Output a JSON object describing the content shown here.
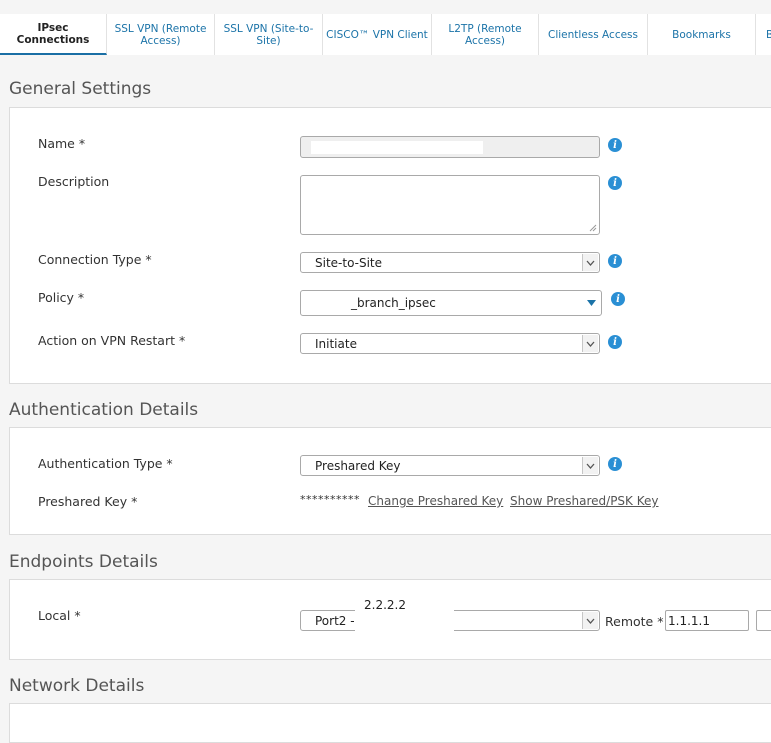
{
  "tabs": [
    {
      "label": "IPsec Connections",
      "active": true
    },
    {
      "label": "SSL VPN (Remote Access)"
    },
    {
      "label": "SSL VPN (Site-to-Site)"
    },
    {
      "label": "CISCO™ VPN Client"
    },
    {
      "label": "L2TP (Remote Access)"
    },
    {
      "label": "Clientless Access"
    },
    {
      "label": "Bookmarks"
    },
    {
      "label": "B"
    }
  ],
  "general": {
    "title": "General Settings",
    "name_label": "Name *",
    "name_value": "",
    "description_label": "Description",
    "description_value": "",
    "connection_type_label": "Connection Type *",
    "connection_type_value": "Site-to-Site",
    "policy_label": "Policy *",
    "policy_value": "_branch_ipsec",
    "action_label": "Action on VPN Restart *",
    "action_value": "Initiate"
  },
  "auth": {
    "title": "Authentication Details",
    "type_label": "Authentication Type *",
    "type_value": "Preshared Key",
    "key_label": "Preshared Key *",
    "key_mask": "**********",
    "change_link": "Change Preshared Key",
    "show_link": "Show Preshared/PSK Key"
  },
  "endpoints": {
    "title": "Endpoints Details",
    "local_label": "Local *",
    "local_value": "Port2 -",
    "local_ip": "2.2.2.2",
    "remote_label": "Remote *",
    "remote_value": "1.1.1.1"
  },
  "network": {
    "title": "Network Details"
  },
  "colors": {
    "accent": "#1b73a8",
    "info": "#2a8fd4"
  },
  "icons": {
    "info": "info-icon",
    "dropdown": "chevron-down-icon"
  }
}
